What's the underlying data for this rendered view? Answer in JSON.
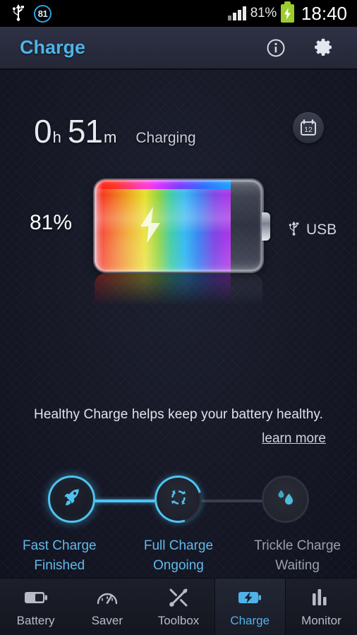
{
  "statusbar": {
    "usb_icon": "usb-icon",
    "badge_value": "81",
    "battery_percent": "81%",
    "battery_icon": "battery-charging-icon",
    "signal_icon": "signal-bars-icon",
    "time": "18:40"
  },
  "header": {
    "title": "Charge",
    "title_color": "#4fb3e8",
    "info_icon": "info-icon",
    "settings_icon": "gear-icon"
  },
  "charge": {
    "hours": "0",
    "hours_unit": "h",
    "minutes": "51",
    "minutes_unit": "m",
    "state": "Charging",
    "calendar_icon": "calendar-icon",
    "calendar_day": "12",
    "battery_percent": "81%",
    "battery_fill_ratio": 81,
    "bolt_icon": "lightning-bolt-icon",
    "source_icon": "usb-icon",
    "source_label": "USB"
  },
  "info": {
    "message": "Healthy Charge helps keep your battery healthy.",
    "learn_more": "learn more"
  },
  "stages": [
    {
      "icon": "rocket-icon",
      "title": "Fast Charge",
      "status": "Finished",
      "state": "done"
    },
    {
      "icon": "refresh-icon",
      "title": "Full Charge",
      "status": "Ongoing",
      "state": "active"
    },
    {
      "icon": "droplet-icon",
      "title": "Trickle Charge",
      "status": "Waiting",
      "state": "idle"
    }
  ],
  "nav": [
    {
      "label": "Battery",
      "icon": "battery-icon",
      "active": false
    },
    {
      "label": "Saver",
      "icon": "gauge-icon",
      "active": false
    },
    {
      "label": "Toolbox",
      "icon": "tools-icon",
      "active": false
    },
    {
      "label": "Charge",
      "icon": "charge-icon",
      "active": true
    },
    {
      "label": "Monitor",
      "icon": "bar-chart-icon",
      "active": false
    }
  ],
  "colors": {
    "accent": "#4fb3e8",
    "background": "#171927",
    "status_green": "#9ccc2e"
  }
}
